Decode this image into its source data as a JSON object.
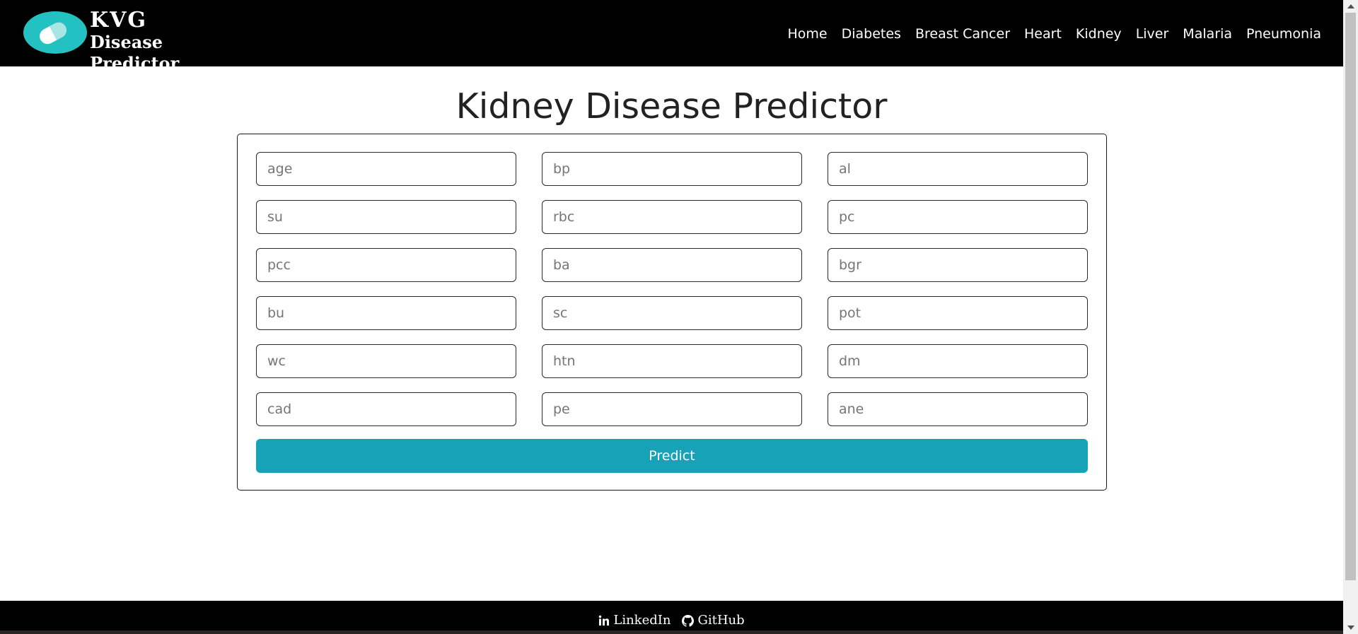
{
  "brand": {
    "line1": "KVG",
    "line2": "Disease Predictor",
    "logo_icon": "pill-capsule-icon",
    "logo_color": "#23c1c1"
  },
  "nav": {
    "items": [
      "Home",
      "Diabetes",
      "Breast Cancer",
      "Heart",
      "Kidney",
      "Liver",
      "Malaria",
      "Pneumonia"
    ]
  },
  "main": {
    "title": "Kidney Disease Predictor",
    "fields": [
      {
        "placeholder": "age",
        "value": ""
      },
      {
        "placeholder": "bp",
        "value": ""
      },
      {
        "placeholder": "al",
        "value": ""
      },
      {
        "placeholder": "su",
        "value": ""
      },
      {
        "placeholder": "rbc",
        "value": ""
      },
      {
        "placeholder": "pc",
        "value": ""
      },
      {
        "placeholder": "pcc",
        "value": ""
      },
      {
        "placeholder": "ba",
        "value": ""
      },
      {
        "placeholder": "bgr",
        "value": ""
      },
      {
        "placeholder": "bu",
        "value": ""
      },
      {
        "placeholder": "sc",
        "value": ""
      },
      {
        "placeholder": "pot",
        "value": ""
      },
      {
        "placeholder": "wc",
        "value": ""
      },
      {
        "placeholder": "htn",
        "value": ""
      },
      {
        "placeholder": "dm",
        "value": ""
      },
      {
        "placeholder": "cad",
        "value": ""
      },
      {
        "placeholder": "pe",
        "value": ""
      },
      {
        "placeholder": "ane",
        "value": ""
      }
    ],
    "predict_label": "Predict"
  },
  "footer": {
    "linkedin_label": "LinkedIn",
    "linkedin_icon": "linkedin-icon",
    "github_label": "GitHub",
    "github_icon": "github-icon"
  },
  "colors": {
    "header_bg": "#000000",
    "button_bg": "#17a2b8",
    "page_bg": "#ffffff"
  }
}
